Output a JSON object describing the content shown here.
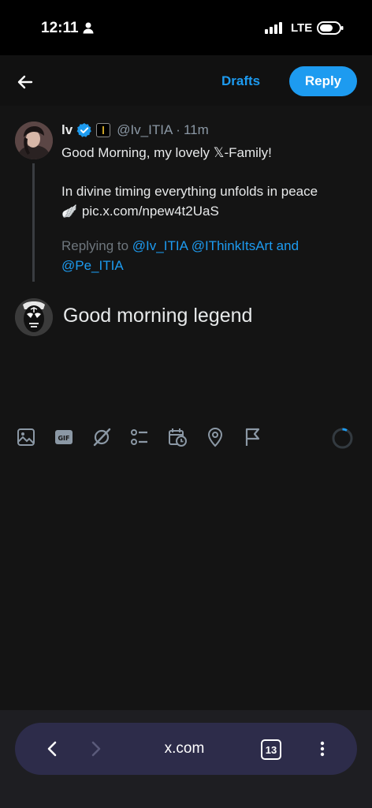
{
  "status_bar": {
    "time": "12:11",
    "network": "LTE",
    "icons": [
      "person-icon",
      "signal-icon",
      "battery-icon"
    ]
  },
  "top_bar": {
    "back_icon": "arrow-left-icon",
    "drafts_label": "Drafts",
    "reply_label": "Reply"
  },
  "original_post": {
    "author_name": "lv",
    "verified": true,
    "handle": "@Iv_ITIA",
    "separator": "·",
    "time_ago": "11m",
    "line1": "Good Morning, my lovely 𝕏-Family!",
    "line2": "In divine timing everything unfolds in peace",
    "emoji": "🪽",
    "link": "pic.x.com/npew4t2UaS"
  },
  "replying_to": {
    "prefix": "Replying to",
    "mention1": "@Iv_ITIA",
    "mention2": "@IThinkItsArt",
    "conjunction": "and",
    "mention3": "@Pe_ITIA"
  },
  "compose": {
    "text": "Good morning legend"
  },
  "toolbar": {
    "icons": [
      "image-icon",
      "gif-icon",
      "grok-icon",
      "poll-icon",
      "schedule-icon",
      "location-icon",
      "flag-icon"
    ]
  },
  "browser": {
    "url": "x.com",
    "tab_count": "13"
  },
  "colors": {
    "accent": "#1d9bf0",
    "background": "#141414",
    "muted": "#6e767d"
  }
}
